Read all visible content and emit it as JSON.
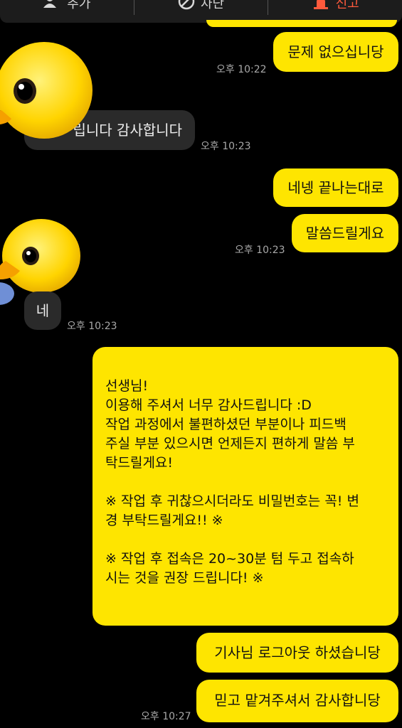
{
  "topbar": {
    "add_label": "추가",
    "block_label": "차단",
    "report_label": "신고"
  },
  "messages": [
    {
      "text": "문제 없으십니당",
      "time": "오후 10:22"
    },
    {
      "text": "립니다 감사합니다",
      "time": "오후 10:23"
    },
    {
      "text": "네넹 끝나는대로"
    },
    {
      "text": "말씀드릴게요",
      "time": "오후 10:23"
    },
    {
      "text": "네",
      "time": "오후 10:23"
    },
    {
      "text": "선생님!\n이용해 주셔서 너무 감사드립니다 :D\n작업 과정에서 불편하셨던 부분이나 피드백\n주실 부분 있으시면 언제든지 편하게 말씀 부\n탁드릴게요!\n\n※ 작업 후 귀찮으시더라도 비밀번호는 꼭! 변\n경 부탁드릴게요!! ※\n\n※ 작업 후 접속은 20~30분 텀 두고 접속하\n시는 것을 권장 드립니다! ※"
    },
    {
      "text": "기사님 로그아웃 하셨습니당"
    },
    {
      "text": "믿고 맡겨주셔서 감사합니당",
      "time": "오후 10:27"
    }
  ],
  "colors": {
    "my_bubble": "#fee500",
    "their_bubble": "#2a2a2a",
    "background": "#000000",
    "report": "#ff5a3c"
  }
}
